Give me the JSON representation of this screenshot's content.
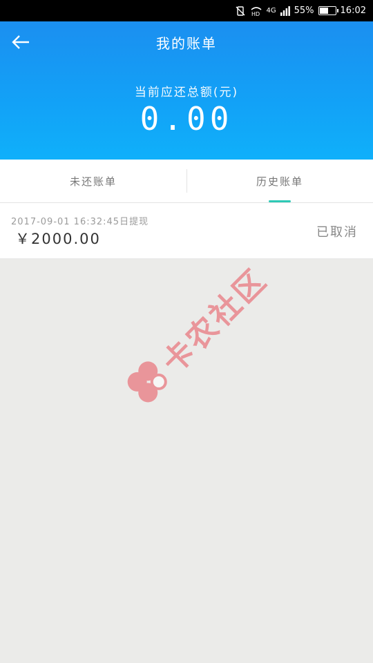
{
  "status_bar": {
    "network": "4G",
    "hd": "HD",
    "battery": "55%",
    "battery_level": 0.55,
    "time": "16:02"
  },
  "header": {
    "title": "我的账单",
    "total_label": "当前应还总额(元)",
    "total_amount": "0.00"
  },
  "tabs": [
    {
      "label": "未还账单",
      "active": false
    },
    {
      "label": "历史账单",
      "active": true
    }
  ],
  "bills": [
    {
      "date": "2017-09-01 16:32:45日提现",
      "amount": "￥2000.00",
      "status": "已取消"
    }
  ],
  "watermark": {
    "text": "卡农社区"
  },
  "colors": {
    "header_top": "#1b8ff0",
    "header_bottom": "#10b0fa",
    "tab_indicator": "#2ec9b6",
    "background": "#ebebe9",
    "watermark": "#e8505b"
  }
}
